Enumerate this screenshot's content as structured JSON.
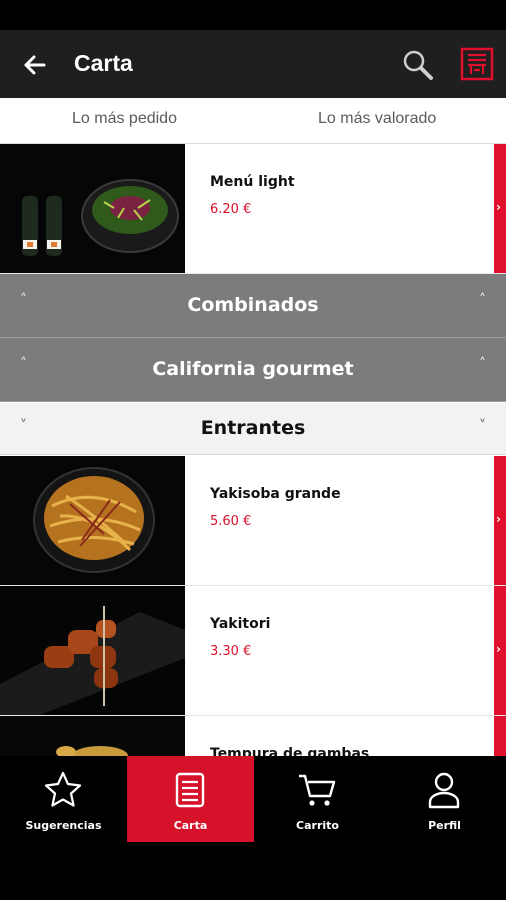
{
  "header": {
    "title": "Carta",
    "back_icon": "arrow-left-icon",
    "search_icon": "search-icon",
    "menu_icon": "restaurant-logo-icon",
    "accent_color": "#d6112a"
  },
  "sort_tabs": [
    {
      "label": "Lo más pedido"
    },
    {
      "label": "Lo más valorado"
    }
  ],
  "items": [
    {
      "name": "Menú light",
      "price": "6.20 €"
    },
    {
      "name": "Yakisoba grande",
      "price": "5.60 €"
    },
    {
      "name": "Yakitori",
      "price": "3.30 €"
    },
    {
      "name": "Tempura de gambas",
      "price": ""
    }
  ],
  "categories": [
    {
      "label": "Combinados",
      "caret": "˄"
    },
    {
      "label": "California gourmet",
      "caret": "˄"
    },
    {
      "label": "Entrantes",
      "caret": "˅"
    }
  ],
  "item_arrow": "›",
  "bottom_nav": [
    {
      "label": "Sugerencias",
      "icon": "star-icon",
      "active": false
    },
    {
      "label": "Carta",
      "icon": "menu-list-icon",
      "active": true
    },
    {
      "label": "Carrito",
      "icon": "cart-icon",
      "active": false
    },
    {
      "label": "Perfil",
      "icon": "user-icon",
      "active": false
    }
  ]
}
